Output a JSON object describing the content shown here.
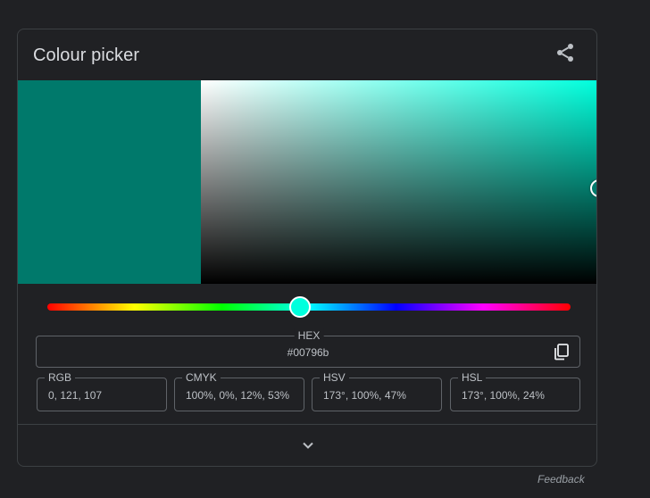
{
  "picker": {
    "title": "Colour picker",
    "current_color": "#00796b",
    "hue_color": "#00ffdd",
    "hex": {
      "label": "HEX",
      "value": "#00796b"
    },
    "formats": [
      {
        "label": "RGB",
        "value": "0, 121, 107"
      },
      {
        "label": "CMYK",
        "value": "100%, 0%, 12%, 53%"
      },
      {
        "label": "HSV",
        "value": "173°, 100%, 47%"
      },
      {
        "label": "HSL",
        "value": "173°, 100%, 24%"
      }
    ],
    "hue_level": 0.481,
    "icons": {
      "share": "share-icon",
      "copy": "copy-icon",
      "expand": "chevron-down-icon"
    }
  },
  "footer": {
    "feedback": "Feedback"
  }
}
